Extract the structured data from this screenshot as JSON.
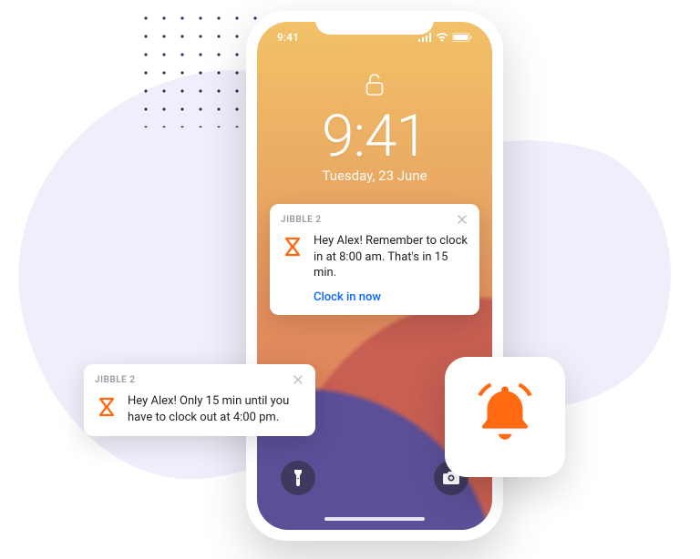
{
  "status": {
    "time": "9:41"
  },
  "lockscreen": {
    "time": "9:41",
    "date": "Tuesday, 23 June"
  },
  "notif_inside": {
    "app": "JIBBLE 2",
    "message": "Hey Alex! Remember to clock in at 8:00 am. That's in 15 min.",
    "action": "Clock in now"
  },
  "notif_outside": {
    "app": "JIBBLE 2",
    "message": "Hey Alex! Only 15 min until you have to clock out at 4:00 pm."
  },
  "colors": {
    "accent": "#FF6A13",
    "link": "#0B69FF"
  }
}
